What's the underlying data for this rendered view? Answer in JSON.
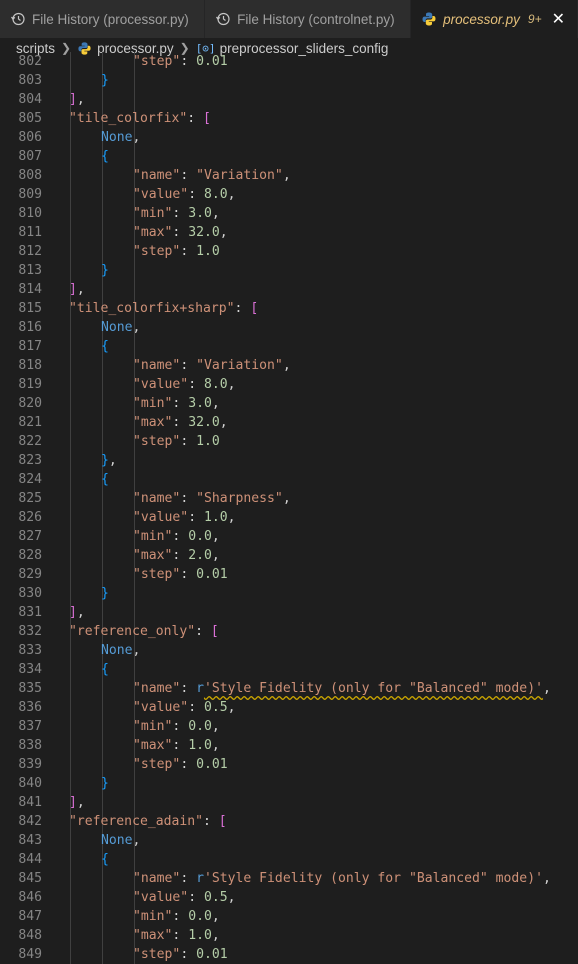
{
  "tabs": [
    {
      "label": "File History (processor.py)",
      "icon": "history-icon",
      "active": false
    },
    {
      "label": "File History (controlnet.py)",
      "icon": "history-icon",
      "active": false
    },
    {
      "label": "processor.py",
      "icon": "python-icon",
      "active": true,
      "badge": "9+",
      "close": "✕"
    }
  ],
  "breadcrumb": {
    "folder": "scripts",
    "file": "processor.py",
    "symbol": "preprocessor_sliders_config",
    "symbol_icon": "[⊙]"
  },
  "colors": {
    "background": "#1e1e1e",
    "string": "#ce9178",
    "number": "#b5cea8",
    "keyword": "#569cd6",
    "bracket_outer": "#da70d6",
    "bracket_inner": "#179fff",
    "active_tab_text": "#e5c07b"
  },
  "editor": {
    "lines": [
      {
        "n": "802",
        "indent": 3,
        "tokens": [
          [
            "key",
            "\"step\""
          ],
          [
            "pun",
            ": "
          ],
          [
            "num",
            "0.01"
          ]
        ]
      },
      {
        "n": "803",
        "indent": 2,
        "tokens": [
          [
            "br2",
            "}"
          ]
        ]
      },
      {
        "n": "804",
        "indent": 1,
        "tokens": [
          [
            "br1",
            "]"
          ],
          [
            "pun",
            ","
          ]
        ]
      },
      {
        "n": "805",
        "indent": 1,
        "tokens": [
          [
            "key",
            "\"tile_colorfix\""
          ],
          [
            "pun",
            ": "
          ],
          [
            "br1",
            "["
          ]
        ]
      },
      {
        "n": "806",
        "indent": 2,
        "tokens": [
          [
            "kw",
            "None"
          ],
          [
            "pun",
            ","
          ]
        ]
      },
      {
        "n": "807",
        "indent": 2,
        "tokens": [
          [
            "br2",
            "{"
          ]
        ]
      },
      {
        "n": "808",
        "indent": 3,
        "tokens": [
          [
            "key",
            "\"name\""
          ],
          [
            "pun",
            ": "
          ],
          [
            "str",
            "\"Variation\""
          ],
          [
            "pun",
            ","
          ]
        ]
      },
      {
        "n": "809",
        "indent": 3,
        "tokens": [
          [
            "key",
            "\"value\""
          ],
          [
            "pun",
            ": "
          ],
          [
            "num",
            "8.0"
          ],
          [
            "pun",
            ","
          ]
        ]
      },
      {
        "n": "810",
        "indent": 3,
        "tokens": [
          [
            "key",
            "\"min\""
          ],
          [
            "pun",
            ": "
          ],
          [
            "num",
            "3.0"
          ],
          [
            "pun",
            ","
          ]
        ]
      },
      {
        "n": "811",
        "indent": 3,
        "tokens": [
          [
            "key",
            "\"max\""
          ],
          [
            "pun",
            ": "
          ],
          [
            "num",
            "32.0"
          ],
          [
            "pun",
            ","
          ]
        ]
      },
      {
        "n": "812",
        "indent": 3,
        "tokens": [
          [
            "key",
            "\"step\""
          ],
          [
            "pun",
            ": "
          ],
          [
            "num",
            "1.0"
          ]
        ]
      },
      {
        "n": "813",
        "indent": 2,
        "tokens": [
          [
            "br2",
            "}"
          ]
        ]
      },
      {
        "n": "814",
        "indent": 1,
        "tokens": [
          [
            "br1",
            "]"
          ],
          [
            "pun",
            ","
          ]
        ]
      },
      {
        "n": "815",
        "indent": 1,
        "tokens": [
          [
            "key",
            "\"tile_colorfix+sharp\""
          ],
          [
            "pun",
            ": "
          ],
          [
            "br1",
            "["
          ]
        ]
      },
      {
        "n": "816",
        "indent": 2,
        "tokens": [
          [
            "kw",
            "None"
          ],
          [
            "pun",
            ","
          ]
        ]
      },
      {
        "n": "817",
        "indent": 2,
        "tokens": [
          [
            "br2",
            "{"
          ]
        ]
      },
      {
        "n": "818",
        "indent": 3,
        "tokens": [
          [
            "key",
            "\"name\""
          ],
          [
            "pun",
            ": "
          ],
          [
            "str",
            "\"Variation\""
          ],
          [
            "pun",
            ","
          ]
        ]
      },
      {
        "n": "819",
        "indent": 3,
        "tokens": [
          [
            "key",
            "\"value\""
          ],
          [
            "pun",
            ": "
          ],
          [
            "num",
            "8.0"
          ],
          [
            "pun",
            ","
          ]
        ]
      },
      {
        "n": "820",
        "indent": 3,
        "tokens": [
          [
            "key",
            "\"min\""
          ],
          [
            "pun",
            ": "
          ],
          [
            "num",
            "3.0"
          ],
          [
            "pun",
            ","
          ]
        ]
      },
      {
        "n": "821",
        "indent": 3,
        "tokens": [
          [
            "key",
            "\"max\""
          ],
          [
            "pun",
            ": "
          ],
          [
            "num",
            "32.0"
          ],
          [
            "pun",
            ","
          ]
        ]
      },
      {
        "n": "822",
        "indent": 3,
        "tokens": [
          [
            "key",
            "\"step\""
          ],
          [
            "pun",
            ": "
          ],
          [
            "num",
            "1.0"
          ]
        ]
      },
      {
        "n": "823",
        "indent": 2,
        "tokens": [
          [
            "br2",
            "}"
          ],
          [
            "pun",
            ","
          ]
        ]
      },
      {
        "n": "824",
        "indent": 2,
        "tokens": [
          [
            "br2",
            "{"
          ]
        ]
      },
      {
        "n": "825",
        "indent": 3,
        "tokens": [
          [
            "key",
            "\"name\""
          ],
          [
            "pun",
            ": "
          ],
          [
            "str",
            "\"Sharpness\""
          ],
          [
            "pun",
            ","
          ]
        ]
      },
      {
        "n": "826",
        "indent": 3,
        "tokens": [
          [
            "key",
            "\"value\""
          ],
          [
            "pun",
            ": "
          ],
          [
            "num",
            "1.0"
          ],
          [
            "pun",
            ","
          ]
        ]
      },
      {
        "n": "827",
        "indent": 3,
        "tokens": [
          [
            "key",
            "\"min\""
          ],
          [
            "pun",
            ": "
          ],
          [
            "num",
            "0.0"
          ],
          [
            "pun",
            ","
          ]
        ]
      },
      {
        "n": "828",
        "indent": 3,
        "tokens": [
          [
            "key",
            "\"max\""
          ],
          [
            "pun",
            ": "
          ],
          [
            "num",
            "2.0"
          ],
          [
            "pun",
            ","
          ]
        ]
      },
      {
        "n": "829",
        "indent": 3,
        "tokens": [
          [
            "key",
            "\"step\""
          ],
          [
            "pun",
            ": "
          ],
          [
            "num",
            "0.01"
          ]
        ]
      },
      {
        "n": "830",
        "indent": 2,
        "tokens": [
          [
            "br2",
            "}"
          ]
        ]
      },
      {
        "n": "831",
        "indent": 1,
        "tokens": [
          [
            "br1",
            "]"
          ],
          [
            "pun",
            ","
          ]
        ]
      },
      {
        "n": "832",
        "indent": 1,
        "tokens": [
          [
            "key",
            "\"reference_only\""
          ],
          [
            "pun",
            ": "
          ],
          [
            "br1",
            "["
          ]
        ]
      },
      {
        "n": "833",
        "indent": 2,
        "tokens": [
          [
            "kw",
            "None"
          ],
          [
            "pun",
            ","
          ]
        ]
      },
      {
        "n": "834",
        "indent": 2,
        "tokens": [
          [
            "br2",
            "{"
          ]
        ]
      },
      {
        "n": "835",
        "indent": 3,
        "tokens": [
          [
            "key",
            "\"name\""
          ],
          [
            "pun",
            ": "
          ],
          [
            "kw",
            "r"
          ],
          [
            "str squig",
            "'Style Fidelity (only for \"Balanced\" mode)'"
          ],
          [
            "pun",
            ","
          ]
        ]
      },
      {
        "n": "836",
        "indent": 3,
        "tokens": [
          [
            "key",
            "\"value\""
          ],
          [
            "pun",
            ": "
          ],
          [
            "num",
            "0.5"
          ],
          [
            "pun",
            ","
          ]
        ]
      },
      {
        "n": "837",
        "indent": 3,
        "tokens": [
          [
            "key",
            "\"min\""
          ],
          [
            "pun",
            ": "
          ],
          [
            "num",
            "0.0"
          ],
          [
            "pun",
            ","
          ]
        ]
      },
      {
        "n": "838",
        "indent": 3,
        "tokens": [
          [
            "key",
            "\"max\""
          ],
          [
            "pun",
            ": "
          ],
          [
            "num",
            "1.0"
          ],
          [
            "pun",
            ","
          ]
        ]
      },
      {
        "n": "839",
        "indent": 3,
        "tokens": [
          [
            "key",
            "\"step\""
          ],
          [
            "pun",
            ": "
          ],
          [
            "num",
            "0.01"
          ]
        ]
      },
      {
        "n": "840",
        "indent": 2,
        "tokens": [
          [
            "br2",
            "}"
          ]
        ]
      },
      {
        "n": "841",
        "indent": 1,
        "tokens": [
          [
            "br1",
            "]"
          ],
          [
            "pun",
            ","
          ]
        ]
      },
      {
        "n": "842",
        "indent": 1,
        "tokens": [
          [
            "key",
            "\"reference_adain\""
          ],
          [
            "pun",
            ": "
          ],
          [
            "br1",
            "["
          ]
        ]
      },
      {
        "n": "843",
        "indent": 2,
        "tokens": [
          [
            "kw",
            "None"
          ],
          [
            "pun",
            ","
          ]
        ]
      },
      {
        "n": "844",
        "indent": 2,
        "tokens": [
          [
            "br2",
            "{"
          ]
        ]
      },
      {
        "n": "845",
        "indent": 3,
        "tokens": [
          [
            "key",
            "\"name\""
          ],
          [
            "pun",
            ": "
          ],
          [
            "kw",
            "r"
          ],
          [
            "str",
            "'Style Fidelity (only for \"Balanced\" mode)'"
          ],
          [
            "pun",
            ","
          ]
        ]
      },
      {
        "n": "846",
        "indent": 3,
        "tokens": [
          [
            "key",
            "\"value\""
          ],
          [
            "pun",
            ": "
          ],
          [
            "num",
            "0.5"
          ],
          [
            "pun",
            ","
          ]
        ]
      },
      {
        "n": "847",
        "indent": 3,
        "tokens": [
          [
            "key",
            "\"min\""
          ],
          [
            "pun",
            ": "
          ],
          [
            "num",
            "0.0"
          ],
          [
            "pun",
            ","
          ]
        ]
      },
      {
        "n": "848",
        "indent": 3,
        "tokens": [
          [
            "key",
            "\"max\""
          ],
          [
            "pun",
            ": "
          ],
          [
            "num",
            "1.0"
          ],
          [
            "pun",
            ","
          ]
        ]
      },
      {
        "n": "849",
        "indent": 3,
        "tokens": [
          [
            "key",
            "\"step\""
          ],
          [
            "pun",
            ": "
          ],
          [
            "num",
            "0.01"
          ]
        ]
      }
    ]
  }
}
